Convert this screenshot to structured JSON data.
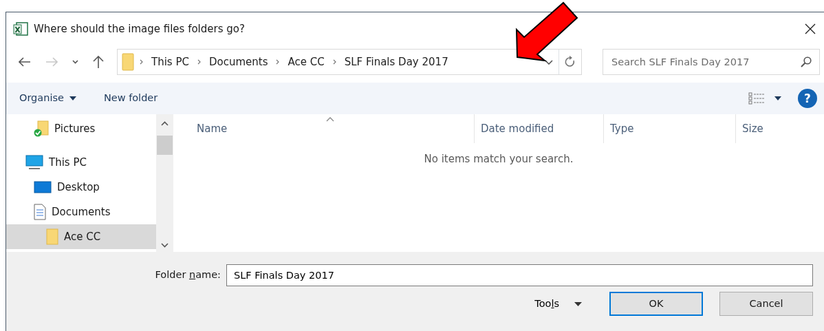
{
  "window": {
    "title": "Where should the image files folders go?"
  },
  "nav": {
    "back_disabled": false,
    "forward_disabled": true,
    "breadcrumb": [
      "This PC",
      "Documents",
      "Ace CC",
      "SLF Finals Day 2017"
    ],
    "search": {
      "placeholder": "Search SLF Finals Day 2017"
    }
  },
  "toolbar": {
    "items": [
      "Organise",
      "New folder"
    ],
    "help": "?"
  },
  "sidebar": {
    "items": [
      {
        "label": "Pictures",
        "kind": "pictures",
        "selected": false
      },
      {
        "label": "This PC",
        "kind": "pc",
        "selected": false,
        "children": [
          {
            "label": "Desktop",
            "kind": "desktop",
            "selected": false
          },
          {
            "label": "Documents",
            "kind": "documents",
            "selected": false,
            "children": [
              {
                "label": "Ace CC",
                "kind": "folder",
                "selected": true
              }
            ]
          }
        ]
      }
    ]
  },
  "table": {
    "columns": [
      "Name",
      "Date modified",
      "Type",
      "Size"
    ],
    "empty_message": "No items match your search."
  },
  "footer": {
    "folder_name": {
      "label_parts": [
        "Folder ",
        "n",
        "ame:"
      ],
      "value": "SLF Finals Day 2017"
    },
    "tools": {
      "label_parts": [
        "Too",
        "l",
        "s"
      ]
    },
    "buttons": [
      {
        "label": "OK",
        "kind": "default"
      },
      {
        "label": "Cancel",
        "kind": "normal"
      }
    ]
  },
  "annotation": {
    "kind": "arrow"
  }
}
